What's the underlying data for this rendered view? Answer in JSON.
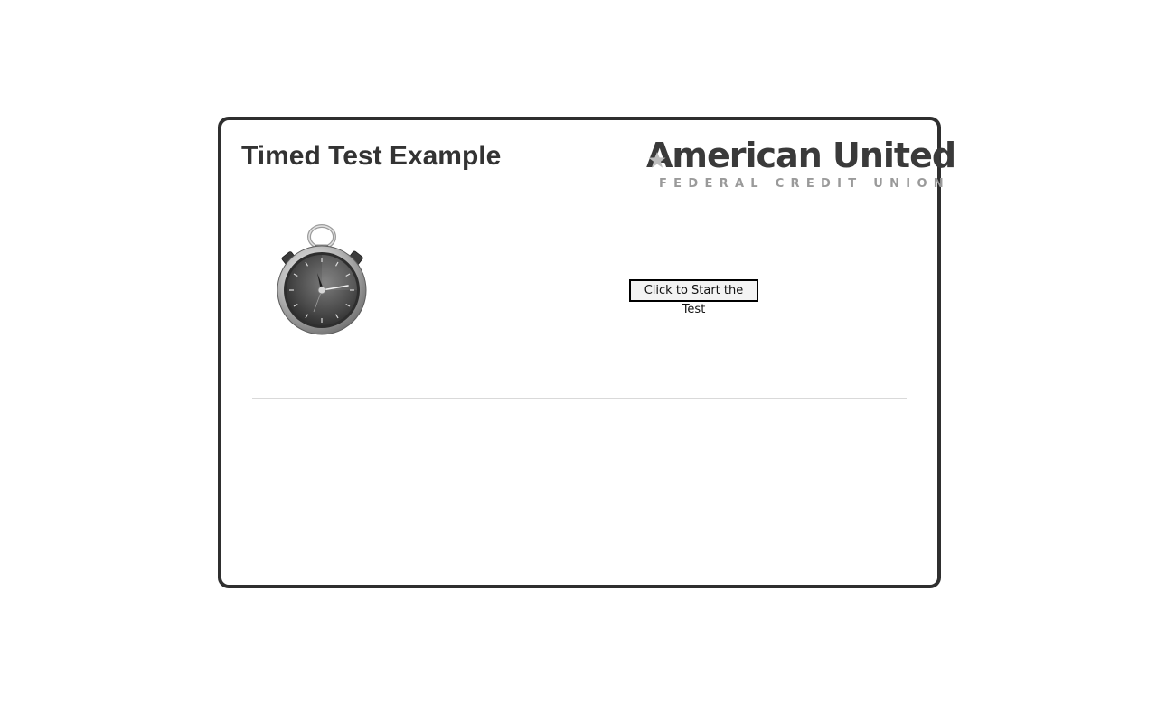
{
  "page": {
    "title": "Timed Test Example"
  },
  "logo": {
    "name": "American United",
    "subtitle": "FEDERAL CREDIT UNION",
    "icon": "star-icon"
  },
  "illustration": {
    "icon": "stopwatch-icon"
  },
  "actions": {
    "start_label": "Click to Start the Test"
  },
  "colors": {
    "border": "#2f2f2f",
    "title": "#333333",
    "logo_main": "#3a3a3a",
    "logo_sub": "#9a9a9a",
    "divider": "#d9d9d9"
  }
}
